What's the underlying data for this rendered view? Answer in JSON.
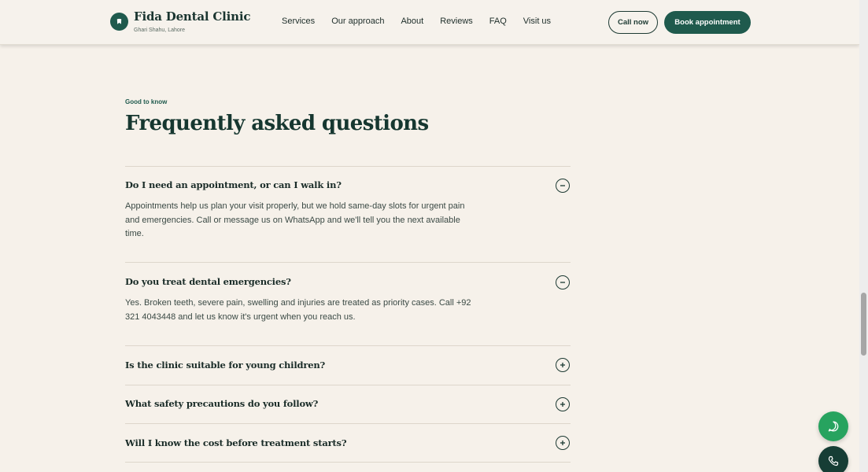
{
  "header": {
    "brand_name": "Fida Dental Clinic",
    "brand_location": "Ghari Shahu, Lahore",
    "logo_icon": "tooth-icon",
    "nav": [
      "Services",
      "Our approach",
      "About",
      "Reviews",
      "FAQ",
      "Visit us"
    ],
    "call_label": "Call now",
    "book_label": "Book appointment"
  },
  "faq_section": {
    "eyebrow": "Good to know",
    "title": "Frequently asked questions",
    "items": [
      {
        "question": "Do I need an appointment, or can I walk in?",
        "answer": "Appointments help us plan your visit properly, but we hold same-day slots for urgent pain and emergencies. Call or message us on WhatsApp and we'll tell you the next available time.",
        "expanded": true
      },
      {
        "question": "Do you treat dental emergencies?",
        "answer": "Yes. Broken teeth, severe pain, swelling and injuries are treated as priority cases. Call +92 321 4043448 and let us know it's urgent when you reach us.",
        "expanded": true
      },
      {
        "question": "Is the clinic suitable for young children?",
        "expanded": false
      },
      {
        "question": "What safety precautions do you follow?",
        "expanded": false
      },
      {
        "question": "Will I know the cost before treatment starts?",
        "expanded": false
      }
    ]
  },
  "floating": {
    "whatsapp_icon": "whatsapp-chat-icon",
    "phone_icon": "phone-icon"
  },
  "colors": {
    "page_bg": "#f6f1ea",
    "accent": "#1f5a4d",
    "whatsapp": "#27a35f",
    "dark_green": "#163d35"
  }
}
